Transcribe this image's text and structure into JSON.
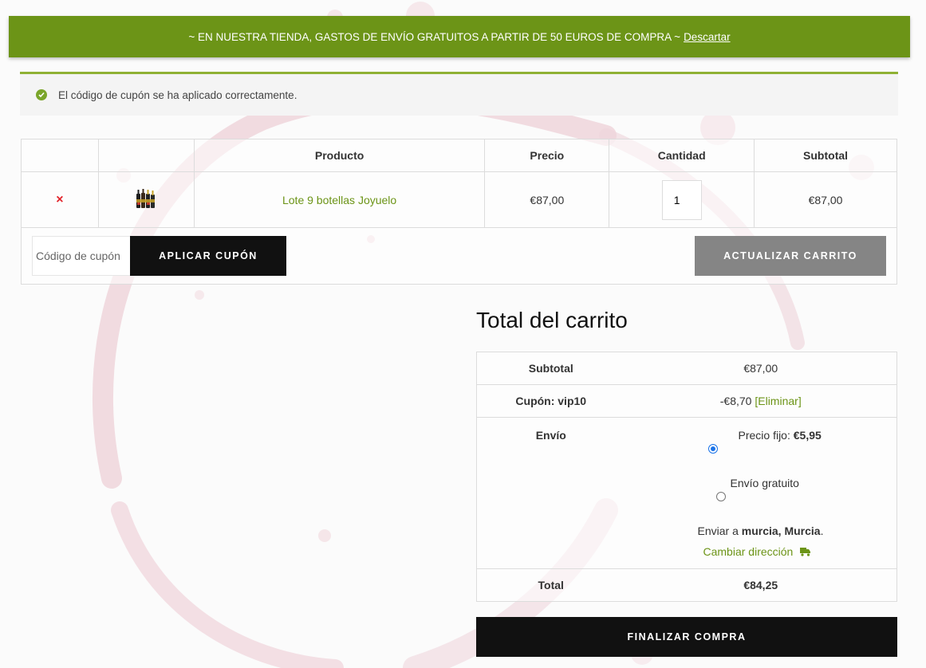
{
  "store_notice": {
    "text": "~ EN NUESTRA TIENDA, GASTOS DE ENVÍO GRATUITOS A PARTIR DE 50 EUROS DE COMPRA ~",
    "dismiss_label": "Descartar"
  },
  "message": {
    "text": "El código de cupón se ha aplicado correctamente."
  },
  "cart_table": {
    "headers": [
      "",
      "",
      "Producto",
      "Precio",
      "Cantidad",
      "Subtotal"
    ],
    "items": [
      {
        "remove_label": "×",
        "name": "Lote 9 botellas Joyuelo",
        "price": "€87,00",
        "quantity": "1",
        "subtotal": "€87,00"
      }
    ],
    "coupon_placeholder": "Código de cupón",
    "apply_coupon_label": "APLICAR CUPÓN",
    "update_cart_label": "ACTUALIZAR CARRITO"
  },
  "totals": {
    "title": "Total del carrito",
    "subtotal_label": "Subtotal",
    "subtotal_value": "€87,00",
    "coupon_label": "Cupón: vip10",
    "coupon_value": "-€8,70",
    "coupon_remove_label": "[Eliminar]",
    "shipping_label": "Envío",
    "shipping_options": [
      {
        "label": "Precio fijo:",
        "price": "€5,95",
        "selected": true
      },
      {
        "label": "Envío gratuito",
        "price": "",
        "selected": false
      }
    ],
    "ship_to_prefix": "Enviar a",
    "ship_to_location": "murcia, Murcia",
    "ship_to_suffix": ".",
    "change_address_label": "Cambiar dirección",
    "total_label": "Total",
    "total_value": "€84,25"
  },
  "checkout_label": "FINALIZAR COMPRA",
  "colors": {
    "brand_green": "#6c9417",
    "notice_bar": "#6c9417",
    "button_dark": "#111111",
    "button_disabled": "#858585",
    "remove_red": "#e2232a"
  },
  "icons": {
    "message": "check-circle-icon",
    "change_address": "truck-icon",
    "remove": "remove-x-icon"
  }
}
